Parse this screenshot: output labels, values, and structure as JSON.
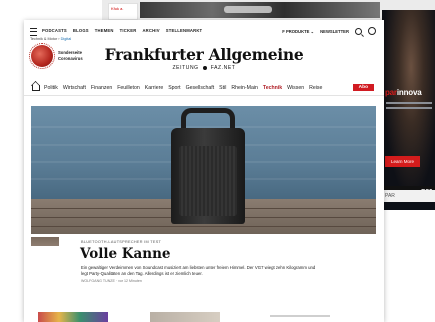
{
  "background": {
    "thumb_text": "Kfuk a."
  },
  "ad": {
    "brand_prefix": "par",
    "brand_suffix": "innova",
    "button": "Learn More",
    "footer": "SUS Systems",
    "footer_logo": "par",
    "strip_text": "PAR"
  },
  "topbar": {
    "nav": [
      "PODCASTS",
      "BLOGS",
      "THEMEN",
      "TICKER",
      "ARCHIV",
      "STELLENMARKT"
    ],
    "products": "F PRODUKTE ⌄",
    "newsletter": "NEWSLETTER"
  },
  "breadcrumb": {
    "path": "Technik & Motor",
    "current": "Digital"
  },
  "badge": {
    "line1": "Sonderseite",
    "line2": "Coronavirus"
  },
  "masthead": {
    "logo": "Frankfurter Allgemeine",
    "sub_left": "ZEITUNG",
    "sub_right": "FAZ.NET"
  },
  "sections": {
    "items": [
      "Politik",
      "Wirtschaft",
      "Finanzen",
      "Feuilleton",
      "Karriere",
      "Sport",
      "Gesellschaft",
      "Stil",
      "Rhein-Main",
      "Technik",
      "Wissen",
      "Reise"
    ],
    "active_index": 9,
    "abo": "Abo"
  },
  "article": {
    "kicker": "BLUETOOTH-LAUTSPRECHER IM TEST",
    "headline": "Volle Kanne",
    "teaser": "Ein gewaltiger Verdeimmen von Soundcast musiziert am liebsten unter freiem Himmel. Der VG7 wiegt zehn Kilogramm und legt Party-Qualitäten an den Tag. Allerdings ist er ziemlich teuer.",
    "meta": "WOLFGANG TUNZE · vor 12 Minuten"
  },
  "colors": {
    "accent": "#d11b22",
    "active_section": "#b01f27",
    "link": "#1a6fb0"
  }
}
